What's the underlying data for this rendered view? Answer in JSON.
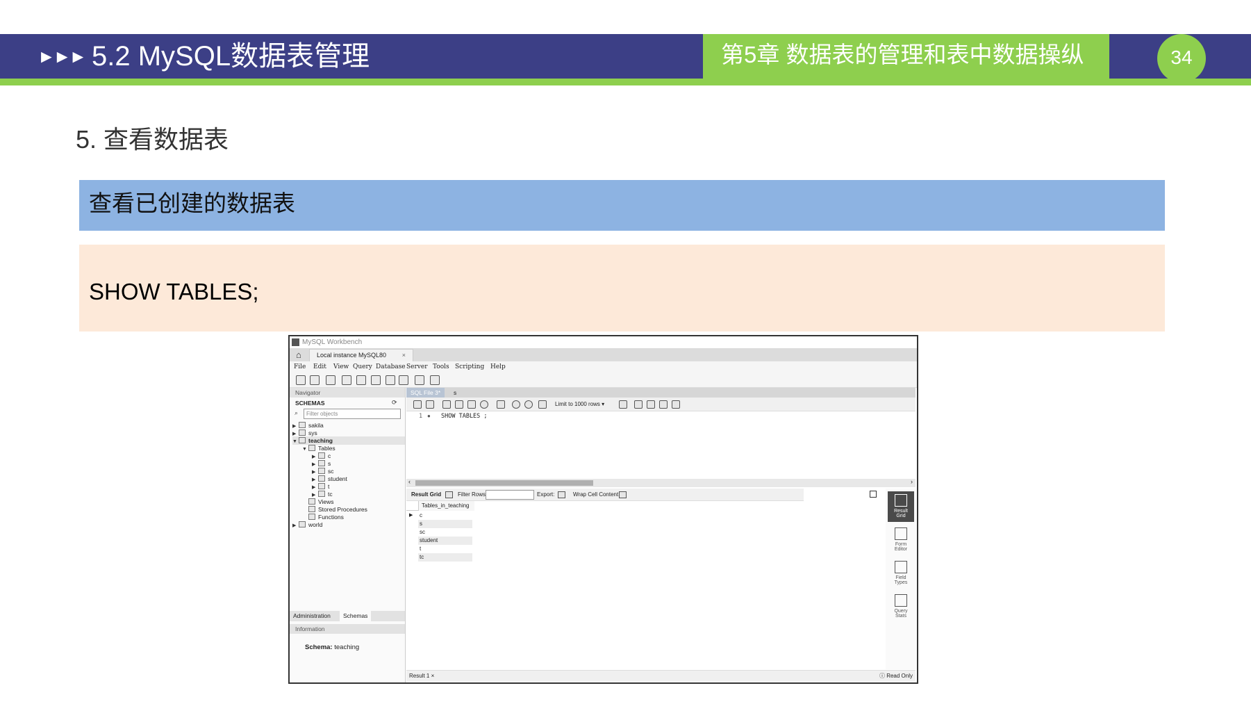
{
  "slide": {
    "header_arrows": "►►►",
    "header_title": "5.2  MySQL数据表管理",
    "chapter": "第5章 数据表的管理和表中数据操纵",
    "page_number": "34",
    "section_heading": "5. 查看数据表",
    "blue_box_text": "查看已创建的数据表",
    "code_text": "SHOW TABLES;",
    "colors": {
      "header_blue": "#3c3f86",
      "accent_green": "#8ecf4e",
      "box_blue": "#8db3e2",
      "box_peach": "#fde9d9"
    }
  },
  "workbench": {
    "window_title": "MySQL Workbench",
    "connection_tab": "Local instance MySQL80",
    "close_glyph": "×",
    "home_icon": "⌂",
    "menu": [
      "File",
      "Edit",
      "View",
      "Query",
      "Database",
      "Server",
      "Tools",
      "Scripting",
      "Help"
    ],
    "navigator": {
      "header": "Navigator",
      "schemas_title": "SCHEMAS",
      "filter_placeholder": "Filter objects",
      "tree": [
        {
          "label": "sakila",
          "tri": "▶"
        },
        {
          "label": "sys",
          "tri": "▶"
        },
        {
          "label": "teaching",
          "tri": "▼"
        },
        {
          "label": "Tables",
          "tri": "▼"
        },
        {
          "label": "c",
          "tri": "▶"
        },
        {
          "label": "s",
          "tri": "▶"
        },
        {
          "label": "sc",
          "tri": "▶"
        },
        {
          "label": "student",
          "tri": "▶"
        },
        {
          "label": "t",
          "tri": "▶"
        },
        {
          "label": "tc",
          "tri": "▶"
        },
        {
          "label": "Views",
          "tri": ""
        },
        {
          "label": "Stored Procedures",
          "tri": ""
        },
        {
          "label": "Functions",
          "tri": ""
        },
        {
          "label": "world",
          "tri": "▶"
        }
      ],
      "tabs": [
        "Administration",
        "Schemas"
      ],
      "info_header": "Information",
      "info_schema_label": "Schema:",
      "info_schema_value": "teaching"
    },
    "editor": {
      "tabs": [
        "SQL File 3*",
        "s"
      ],
      "limit_label": "Limit to 1000 rows",
      "line_number": "1",
      "line_dot": "●",
      "sql": "SHOW TABLES ;"
    },
    "result": {
      "result_grid_label": "Result Grid",
      "filter_rows_label": "Filter Rows:",
      "export_label": "Export:",
      "wrap_label": "Wrap Cell Content:",
      "column_header": "Tables_in_teaching",
      "rows": [
        "c",
        "s",
        "sc",
        "student",
        "t",
        "tc"
      ],
      "row_marker": "▶",
      "bottom_tab": "Result 1",
      "read_only": "Read Only",
      "side_buttons": [
        {
          "line1": "Result",
          "line2": "Grid"
        },
        {
          "line1": "Form",
          "line2": "Editor"
        },
        {
          "line1": "Field",
          "line2": "Types"
        },
        {
          "line1": "Query",
          "line2": "Stats"
        }
      ]
    }
  }
}
